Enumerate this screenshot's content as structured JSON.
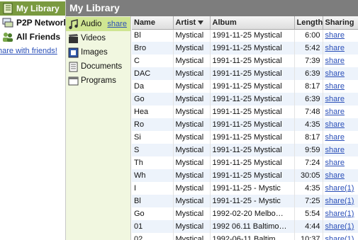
{
  "nav": {
    "my_library": "My Library",
    "p2p_network": "P2P Network",
    "all_friends": "All Friends",
    "share_with_friends": "hare with friends!"
  },
  "header": {
    "title": "My Library"
  },
  "categories": {
    "audio": "Audio",
    "audio_share": "share",
    "videos": "Videos",
    "images": "Images",
    "documents": "Documents",
    "programs": "Programs"
  },
  "table": {
    "columns": {
      "name": "Name",
      "artist": "Artist",
      "album": "Album",
      "length": "Length",
      "sharing": "Sharing"
    },
    "sort_column": "artist",
    "rows": [
      {
        "name": "Bl",
        "artist": "Mystical",
        "album": "1991-11-25 Mystical",
        "length": "6:00",
        "sharing": "share"
      },
      {
        "name": "Bro",
        "artist": "Mystical",
        "album": "1991-11-25 Mystical",
        "length": "5:42",
        "sharing": "share"
      },
      {
        "name": "C",
        "artist": "Mystical",
        "album": "1991-11-25 Mystical",
        "length": "7:39",
        "sharing": "share"
      },
      {
        "name": "DAC",
        "artist": "Mystical",
        "album": "1991-11-25 Mystical",
        "length": "6:39",
        "sharing": "share"
      },
      {
        "name": "Da",
        "artist": "Mystical",
        "album": "1991-11-25 Mystical",
        "length": "8:17",
        "sharing": "share"
      },
      {
        "name": "Go",
        "artist": "Mystical",
        "album": "1991-11-25 Mystical",
        "length": "6:39",
        "sharing": "share"
      },
      {
        "name": "Hea",
        "artist": "Mystical",
        "album": "1991-11-25 Mystical",
        "length": "7:48",
        "sharing": "share"
      },
      {
        "name": "Ro",
        "artist": "Mystical",
        "album": "1991-11-25 Mystical",
        "length": "4:35",
        "sharing": "share"
      },
      {
        "name": "Si",
        "artist": "Mystical",
        "album": "1991-11-25 Mystical",
        "length": "8:17",
        "sharing": "share"
      },
      {
        "name": "S",
        "artist": "Mystical",
        "album": "1991-11-25 Mystical",
        "length": "9:59",
        "sharing": "share"
      },
      {
        "name": "Th",
        "artist": "Mystical",
        "album": "1991-11-25 Mystical",
        "length": "7:24",
        "sharing": "share"
      },
      {
        "name": "Wh",
        "artist": "Mystical",
        "album": "1991-11-25 Mystical",
        "length": "30:05",
        "sharing": "share"
      },
      {
        "name": "I",
        "artist": "Mystical",
        "album": "1991-11-25 - Mystic",
        "length": "4:35",
        "sharing": "share(1)"
      },
      {
        "name": "Bl",
        "artist": "Mystical",
        "album": "1991-11-25 - Mystic",
        "length": "7:25",
        "sharing": "share(1)"
      },
      {
        "name": "Go",
        "artist": "Mystical",
        "album": "1992-02-20 Melbo…",
        "length": "5:54",
        "sharing": "share(1)"
      },
      {
        "name": "01",
        "artist": "Mystical",
        "album": "1992 06.11 Baltimo…",
        "length": "4:44",
        "sharing": "share(1)"
      },
      {
        "name": "02",
        "artist": "Mystical",
        "album": "1992-06-11 Baltim…",
        "length": "10:37",
        "sharing": "share(1)"
      }
    ]
  },
  "colors": {
    "selected_nav": "#7a9a40",
    "header_bg": "#7d7d7d",
    "category_bg": "#f1f7e0",
    "selected_category": "#cfe592",
    "link": "#2a4fb8",
    "row_alt": "#edf3fb"
  },
  "icons": {
    "my_library": "library-book-icon",
    "p2p_network": "network-computer-icon",
    "all_friends": "friends-people-icon",
    "audio": "music-note-icon",
    "videos": "film-clapper-icon",
    "images": "picture-icon",
    "documents": "document-icon",
    "programs": "program-window-icon"
  }
}
